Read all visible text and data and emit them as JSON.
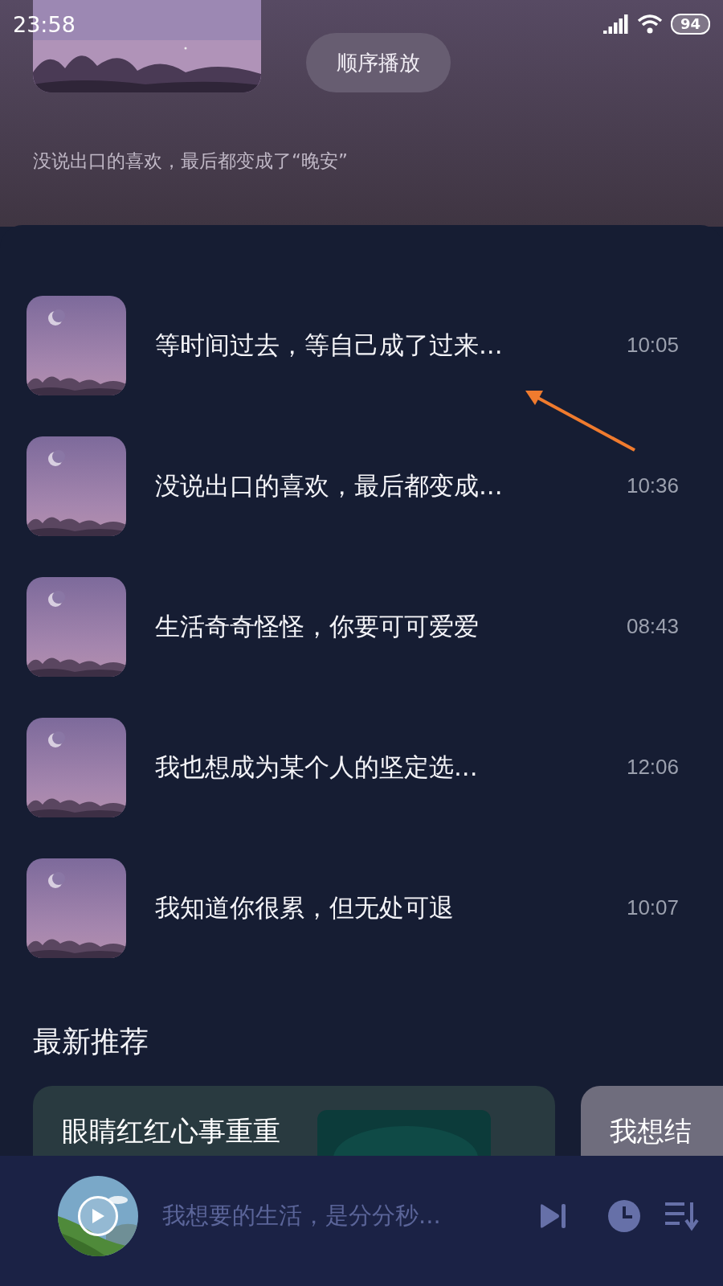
{
  "status_bar": {
    "time": "23:58",
    "battery": "94"
  },
  "header": {
    "play_mode_button": "顺序播放",
    "description": "没说出口的喜欢，最后都变成了“晚安”"
  },
  "tracks": [
    {
      "title": "等时间过去，等自己成了过来...",
      "duration": "10:05"
    },
    {
      "title": "没说出口的喜欢，最后都变成...",
      "duration": "10:36"
    },
    {
      "title": "生活奇奇怪怪，你要可可爱爱",
      "duration": "08:43"
    },
    {
      "title": "我也想成为某个人的坚定选...",
      "duration": "12:06"
    },
    {
      "title": "我知道你很累，但无处可退",
      "duration": "10:07"
    }
  ],
  "section_title": "最新推荐",
  "recommendations": [
    {
      "title": "眼睛红红心事重重"
    },
    {
      "kind": "text",
      "title": "我想结"
    }
  ],
  "player": {
    "now_playing": "我想要的生活，是分分秒..."
  }
}
